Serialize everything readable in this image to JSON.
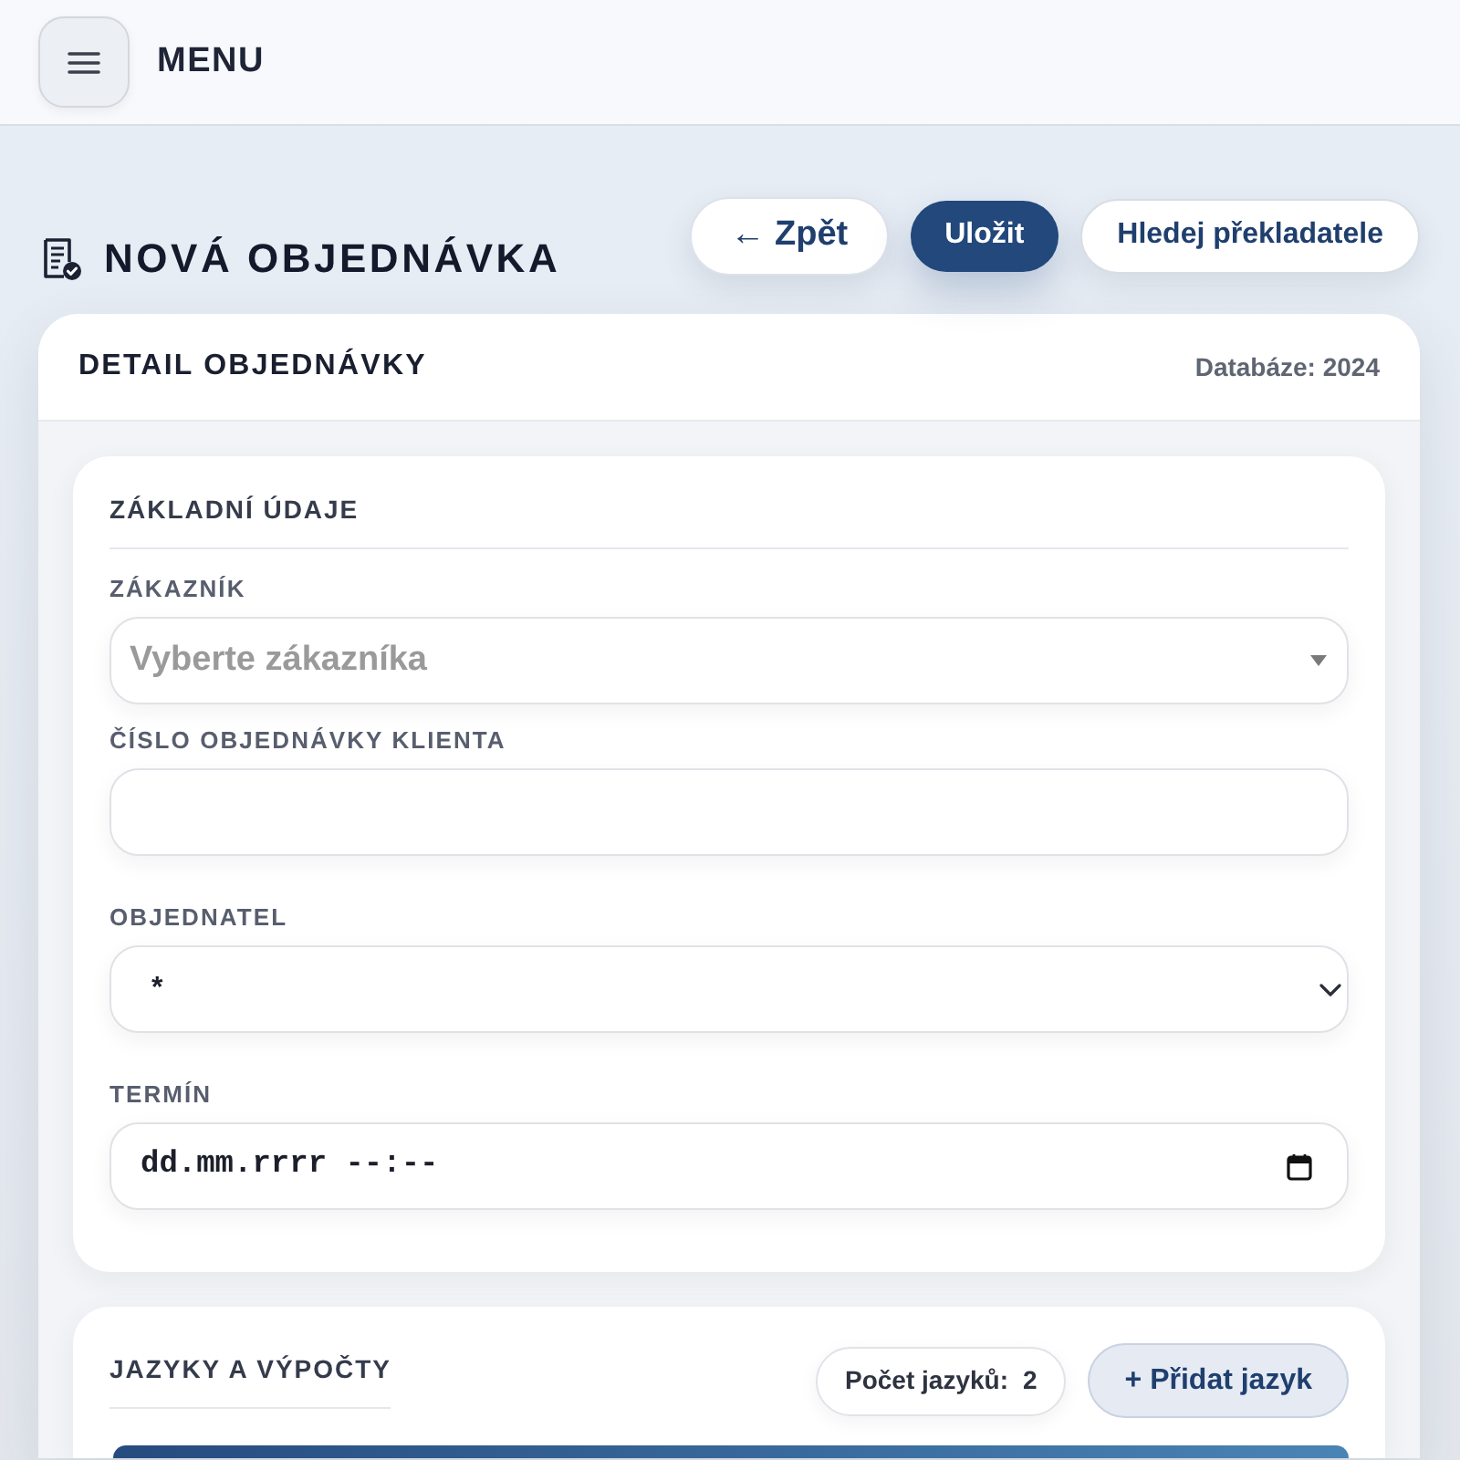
{
  "header": {
    "menu_label": "MENU"
  },
  "page": {
    "title": "NOVÁ OBJEDNÁVKA",
    "actions": [
      {
        "label": "← Zpět",
        "kind": "secondary"
      },
      {
        "label": "Uložit",
        "kind": "primary"
      },
      {
        "label": "Hledej překladatele",
        "kind": "outline"
      }
    ]
  },
  "detail_card": {
    "title": "DETAIL OBJEDNÁVKY",
    "database": "Databáze: 2024",
    "basic_section": {
      "title": "ZÁKLADNÍ ÚDAJE",
      "fields": [
        {
          "label": "ZÁKAZNÍK",
          "kind": "select",
          "placeholder": "Vyberte zákazníka"
        },
        {
          "label": "ČÍSLO OBJEDNÁVKY KLIENTA",
          "kind": "text"
        },
        {
          "label": "OBJEDNATEL",
          "kind": "dropdown",
          "value": "*"
        },
        {
          "label": "TERMÍN",
          "kind": "datetime",
          "placeholder": "dd.mm.rrrr --:--"
        }
      ]
    },
    "languages_section": {
      "title": "JAZYKY A VÝPOČTY",
      "count_label": "Počet jazyků:",
      "count": "2",
      "add_button": "+ Přidat jazyk"
    }
  }
}
